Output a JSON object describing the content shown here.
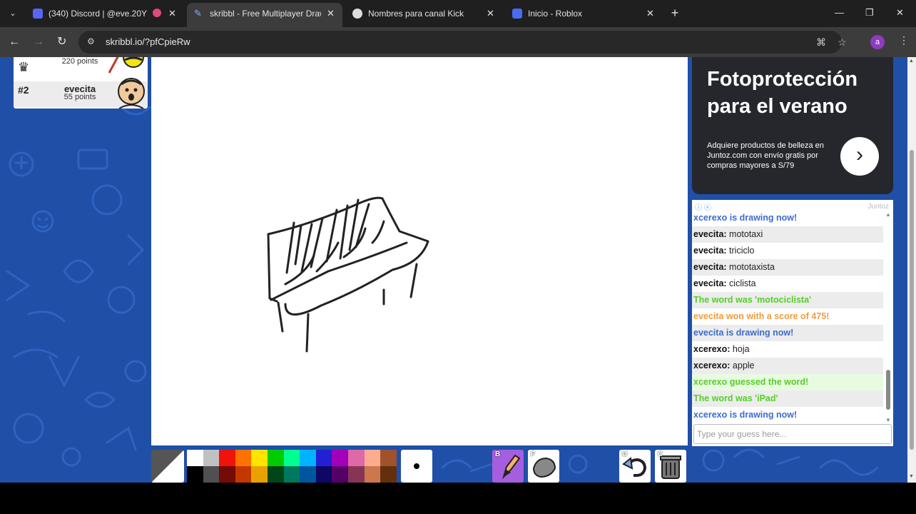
{
  "browser": {
    "tabs": [
      {
        "title": "(340) Discord | @eve.20Y",
        "badge": "340"
      },
      {
        "title": "skribbl - Free Multiplayer Draw"
      },
      {
        "title": "Nombres para canal Kick"
      },
      {
        "title": "Inicio - Roblox"
      }
    ],
    "url": "skribbl.io/?pfCpieRw",
    "profile_initial": "a"
  },
  "players": [
    {
      "rank": "",
      "name": "",
      "points": "220 points"
    },
    {
      "rank": "#2",
      "name": "evecita",
      "points": "55 points"
    }
  ],
  "ad": {
    "headline": "Fotoprotección para el verano",
    "body": "Adquiere productos de belleza en Juntoz.com con envío gratis por compras mayores a S/79",
    "source": "Juntoz"
  },
  "chat": {
    "messages": [
      {
        "kind": "blue",
        "text": "xcerexo is drawing now!"
      },
      {
        "kind": "guess",
        "who": "evecita:",
        "text": "mototaxi"
      },
      {
        "kind": "guess",
        "who": "evecita:",
        "text": "triciclo"
      },
      {
        "kind": "guess",
        "who": "evecita:",
        "text": "mototaxista"
      },
      {
        "kind": "guess",
        "who": "evecita:",
        "text": "ciclista"
      },
      {
        "kind": "green",
        "text": "The word was 'motociclista'"
      },
      {
        "kind": "orange",
        "text": "evecita won with a score of 475!"
      },
      {
        "kind": "blue",
        "text": "evecita is drawing now!"
      },
      {
        "kind": "guess",
        "who": "xcerexo:",
        "text": "hoja"
      },
      {
        "kind": "guess",
        "who": "xcerexo:",
        "text": "apple"
      },
      {
        "kind": "green",
        "text": "xcerexo guessed the word!"
      },
      {
        "kind": "green",
        "text": "The word was 'iPad'"
      },
      {
        "kind": "blue",
        "text": "xcerexo is drawing now!"
      }
    ],
    "input_placeholder": "Type your guess here..."
  },
  "toolbar": {
    "palette_top": [
      "#ffffff",
      "#c1c1c1",
      "#ef130b",
      "#ff7100",
      "#ffe400",
      "#00cc00",
      "#00ff91",
      "#00b2ff",
      "#231fd3",
      "#a300ba",
      "#df69a7",
      "#ffac8e",
      "#a0522d"
    ],
    "palette_bottom": [
      "#000000",
      "#505050",
      "#740b07",
      "#c23800",
      "#e8a200",
      "#004619",
      "#00785d",
      "#00569e",
      "#0e0865",
      "#550069",
      "#873554",
      "#cc774d",
      "#63300d"
    ],
    "pen_key": "B",
    "fill_key": "F",
    "undo_key": "U",
    "clear_key": "C"
  }
}
